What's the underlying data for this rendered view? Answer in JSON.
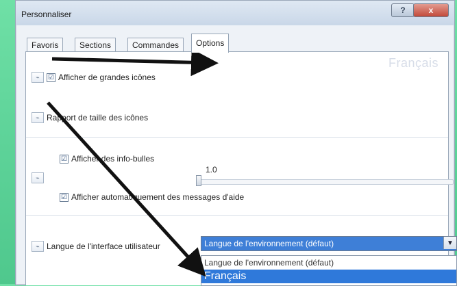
{
  "window": {
    "title": "Personnaliser"
  },
  "title_buttons": {
    "help": "?",
    "close": "x"
  },
  "tabs": [
    {
      "label": "Favoris"
    },
    {
      "label": "Sections"
    },
    {
      "label": "Commandes"
    },
    {
      "label": "Options"
    }
  ],
  "overlay_text": "Français",
  "options": {
    "large_icons": "Afficher de grandes icônes",
    "icon_ratio_label": "Rapport de taille des icônes",
    "icon_ratio_value": "1.0",
    "show_tooltips": "Afficher des info-bulles",
    "auto_help": "Afficher automatiquement des messages d'aide",
    "language_label": "Langue de l'interface utilisateur"
  },
  "language_select": {
    "selected": "Langue de l'environnement (défaut)",
    "options": [
      "Langue de l'environnement (défaut)",
      "Français"
    ]
  },
  "icons": {
    "row_icon": "pin-icon",
    "checkbox_checked": "☑"
  },
  "colors": {
    "accent": "#2f79da",
    "background": "#5fd49a",
    "arrow": "#111111"
  }
}
